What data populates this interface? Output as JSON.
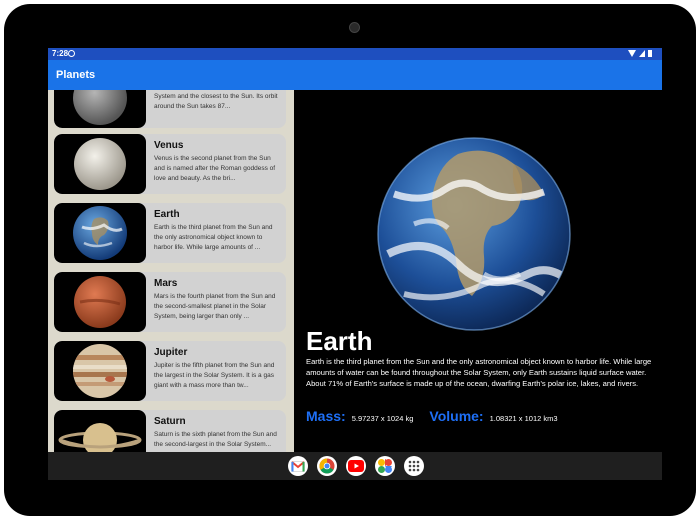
{
  "status": {
    "time": "7:28"
  },
  "app": {
    "title": "Planets"
  },
  "planets": [
    {
      "name": "",
      "description": "Mercury is the smallest planet in the Solar System and the closest to the Sun. Its orbit around the Sun takes 87..."
    },
    {
      "name": "Venus",
      "description": "Venus is the second planet from the Sun and is named after the Roman goddess of love and beauty. As the bri..."
    },
    {
      "name": "Earth",
      "description": "Earth is the third planet from the Sun and the only astronomical object known to harbor life. While large amounts of ..."
    },
    {
      "name": "Mars",
      "description": "Mars is the fourth planet from the Sun and the second-smallest planet in the Solar System, being larger than only ..."
    },
    {
      "name": "Jupiter",
      "description": "Jupiter is the fifth planet from the Sun and the largest in the Solar System. It is a gas giant with a mass more than tw..."
    },
    {
      "name": "Saturn",
      "description": "Saturn is the sixth planet from the Sun and the second-largest in the Solar System..."
    }
  ],
  "detail": {
    "title": "Earth",
    "description": "Earth is the third planet from the Sun and the only astronomical object known to harbor life. While large amounts of water can be found throughout the Solar System, only Earth sustains liquid surface water. About 71% of Earth's surface is made up of the ocean, dwarfing Earth's polar ice, lakes, and rivers.",
    "mass_label": "Mass:",
    "mass_value": "5.97237 x 1024 kg",
    "volume_label": "Volume:",
    "volume_value": "1.08321 x 1012 km3"
  },
  "dock": [
    "gmail-icon",
    "chrome-icon",
    "youtube-icon",
    "photos-icon",
    "apps-icon"
  ],
  "colors": {
    "appbar": "#1a73e8",
    "accent": "#1e6ff5",
    "list_bg": "#dcd9cc",
    "card_bg": "#d2d2d2"
  }
}
